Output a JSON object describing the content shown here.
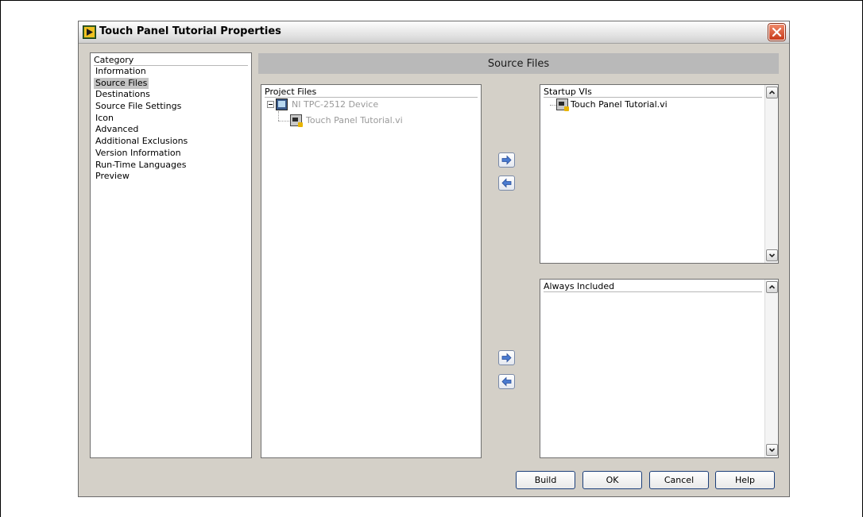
{
  "window": {
    "title": "Touch Panel Tutorial Properties"
  },
  "category": {
    "header": "Category",
    "items": [
      "Information",
      "Source Files",
      "Destinations",
      "Source File Settings",
      "Icon",
      "Advanced",
      "Additional Exclusions",
      "Version Information",
      "Run-Time Languages",
      "Preview"
    ],
    "selected": "Source Files"
  },
  "section": {
    "title": "Source Files"
  },
  "project_files": {
    "header": "Project Files",
    "device": "NI TPC-2512 Device",
    "vi": "Touch Panel Tutorial.vi"
  },
  "startup_vis": {
    "header": "Startup VIs",
    "items": [
      "Touch Panel Tutorial.vi"
    ]
  },
  "always_included": {
    "header": "Always Included",
    "items": []
  },
  "buttons": {
    "build": "Build",
    "ok": "OK",
    "cancel": "Cancel",
    "help": "Help"
  },
  "icons": {
    "title": "labview-project-icon",
    "close": "close-icon",
    "device": "touch-panel-device-icon",
    "vi": "vi-file-icon",
    "move_right": "arrow-right-icon",
    "move_left": "arrow-left-icon",
    "scroll_up": "scroll-up-icon",
    "scroll_down": "scroll-down-icon"
  },
  "colors": {
    "dialog_background": "#d4d0c8",
    "section_header": "#b9b9b9",
    "close_button": "#d8502c",
    "arrow_fill": "#4a7bd0",
    "selected_category": "#c4c4c4"
  }
}
